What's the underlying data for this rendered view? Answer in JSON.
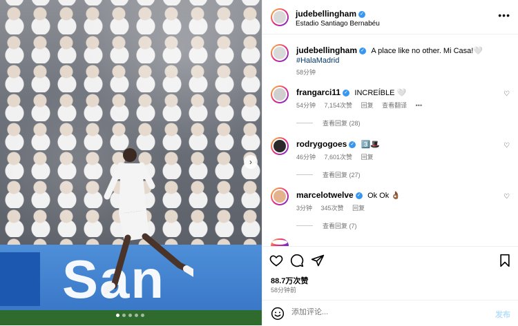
{
  "post": {
    "username": "judebellingham",
    "location": "Estadio Santiago Bernabéu",
    "caption": "A place like no other. Mi Casa!🤍",
    "hashtag": "#HalaMadrid",
    "caption_time": "58分钟"
  },
  "photo": {
    "board_text": "San",
    "carousel_dots": 5,
    "active_dot": 0
  },
  "comments": [
    {
      "username": "frangarci11",
      "text": "INCREÍBLE 🤍",
      "time": "54分钟",
      "likes": "7,154次赞",
      "reply": "回复",
      "translate": "查看翻译",
      "more": "•••",
      "view_replies": "查看回复 (28)"
    },
    {
      "username": "rodrygogoes",
      "text": "3️⃣🎩",
      "time": "46分钟",
      "likes": "7,601次赞",
      "reply": "回复",
      "view_replies": "查看回复 (27)"
    },
    {
      "username": "marcelotwelve",
      "text": "Ok Ok 👌🏾",
      "time": "3分钟",
      "likes": "345次赞",
      "reply": "回复",
      "view_replies": "查看回复 (7)"
    }
  ],
  "actions": {
    "likes": "88.7万次赞",
    "time": "58分钟前",
    "comment_placeholder": "添加评论...",
    "post_label": "发布"
  },
  "colors": {
    "link": "#00376b",
    "verified": "#3797f0",
    "muted": "#737373",
    "post_disabled": "#b2dffc"
  }
}
